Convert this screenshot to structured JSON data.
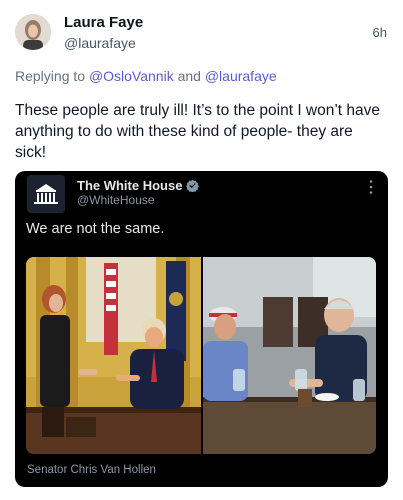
{
  "post": {
    "author_name": "Laura Faye",
    "author_handle": "@laurafaye",
    "timestamp": "6h",
    "reply_prefix": "Replying to",
    "reply_mention_1": "@OsloVannik",
    "reply_and": "and",
    "reply_mention_2": "@laurafaye",
    "text": "These people are truly ill! It’s to the point I won’t have anything to do with these kind of people- they are sick!"
  },
  "embed": {
    "name": "The White House",
    "handle": "@WhiteHouse",
    "text": "We are not the same.",
    "caption": "Senator Chris Van Hollen"
  },
  "icons": {
    "verified": "verified-badge-icon",
    "more": "more-options-icon"
  },
  "colors": {
    "mention": "#5b5bd6",
    "card_background": "#000000",
    "verified_badge": "#829aab"
  }
}
